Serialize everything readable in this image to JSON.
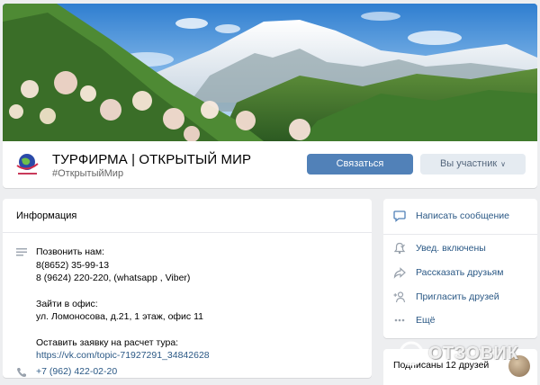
{
  "cover": {
    "alt_icon": "mountain-cover-image"
  },
  "header": {
    "title": "ТУРФИРМА | ОТКРЫТЫЙ МИР",
    "hashtag": "#ОткрытыйМир",
    "contact_button": "Связаться",
    "member_button": "Вы участник"
  },
  "info": {
    "title": "Информация",
    "call_label": "Позвонить нам:",
    "phone1": "8(8652) 35-99-13",
    "phone2": "8 (9624) 220-220, (whatsapp , Viber)",
    "office_label": "Зайти в офис:",
    "office_address": "ул. Ломоносова, д.21, 1 этаж, офис 11",
    "request_label": "Оставить заявку на расчет тура:",
    "request_link": "https://vk.com/topic-71927291_34842628",
    "phone3": "+7 (962) 422-02-20"
  },
  "actions": {
    "write_message": "Написать сообщение",
    "notifications": "Увед. включены",
    "tell_friends": "Рассказать друзьям",
    "invite_friends": "Пригласить друзей",
    "more": "Ещё"
  },
  "subscribers": {
    "label": "Подписаны 12 друзей"
  },
  "watermark": {
    "text": "ОТЗОВИК"
  },
  "colors": {
    "accent": "#5181b8",
    "link": "#2a5885",
    "background": "#edeef0"
  }
}
